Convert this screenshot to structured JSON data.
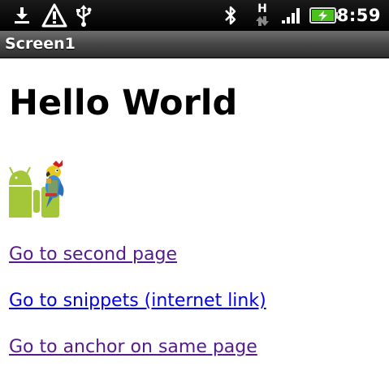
{
  "status_bar": {
    "icons": [
      "download-icon",
      "warning-icon",
      "usb-icon",
      "bluetooth-icon",
      "hsdpa-data-icon",
      "signal-icon",
      "battery-charging-icon"
    ],
    "time": "8:59",
    "data_type_label": "H",
    "battery_color": "#4cc01e"
  },
  "title_bar": {
    "title": "Screen1"
  },
  "main": {
    "heading": "Hello World",
    "logo_icon": "android-parrot-logo-icon",
    "links": [
      {
        "label": "Go to second page",
        "state": "visited"
      },
      {
        "label": "Go to snippets (internet link)",
        "state": "unvisited"
      },
      {
        "label": "Go to anchor on same page",
        "state": "visited"
      }
    ]
  },
  "colors": {
    "visited_link": "#551a8b",
    "unvisited_link": "#0000ee",
    "android_green": "#a4c639"
  }
}
